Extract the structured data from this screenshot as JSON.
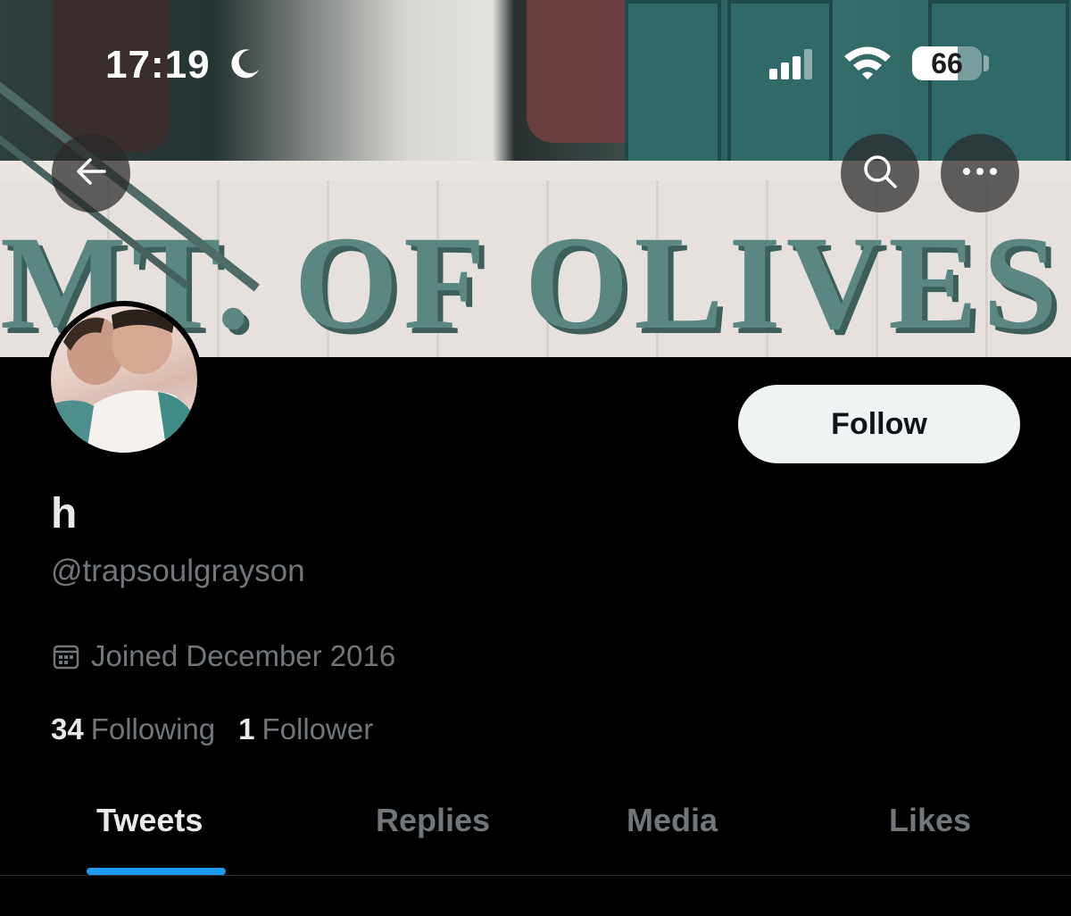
{
  "status_bar": {
    "time": "17:19",
    "battery_percent": "66",
    "battery_level": 0.66,
    "icons": [
      "moon-icon",
      "signal-icon",
      "wifi-icon",
      "battery-icon"
    ]
  },
  "banner": {
    "sign_text": "MT. OF OLIVES"
  },
  "nav": {
    "back_icon": "arrow-left-icon",
    "search_icon": "search-icon",
    "more_icon": "more-horizontal-icon"
  },
  "profile": {
    "follow_label": "Follow",
    "display_name": "h",
    "handle": "@trapsoulgrayson",
    "joined": "Joined December 2016",
    "following_count": "34",
    "following_label": "Following",
    "followers_count": "1",
    "followers_label": "Follower"
  },
  "tabs": [
    {
      "label": "Tweets",
      "active": true
    },
    {
      "label": "Replies",
      "active": false
    },
    {
      "label": "Media",
      "active": false
    },
    {
      "label": "Likes",
      "active": false
    }
  ],
  "colors": {
    "accent": "#1d9bf0",
    "background": "#000000",
    "muted_text": "#71767b",
    "primary_text": "#e7e9ea"
  }
}
